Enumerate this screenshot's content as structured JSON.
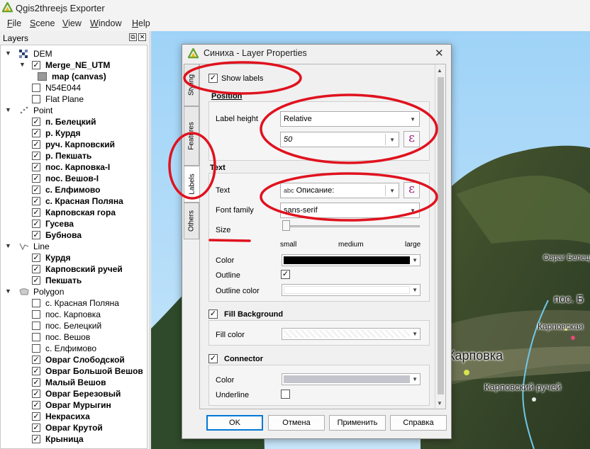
{
  "app": {
    "title": "Qgis2threejs Exporter",
    "accent": "#65a32d"
  },
  "menu": [
    {
      "label": "File",
      "u": "F",
      "rest": "ile"
    },
    {
      "label": "Scene",
      "u": "S",
      "rest": "cene"
    },
    {
      "label": "View",
      "u": "V",
      "rest": "iew"
    },
    {
      "label": "Window",
      "u": "W",
      "rest": "indow"
    },
    {
      "label": "Help",
      "u": "H",
      "rest": "elp"
    }
  ],
  "layers_panel": {
    "title": "Layers",
    "float_icon": "⧉",
    "close_icon": "✕",
    "items": [
      {
        "label": "DEM",
        "level": 0,
        "expand": "▼",
        "icon": "dem-group-icon",
        "bold": false
      },
      {
        "label": "Merge_NE_UTM",
        "level": 1,
        "expand": "▼",
        "checked": true,
        "bold": true
      },
      {
        "label": "map (canvas)",
        "level": 2,
        "icon": "raster-icon",
        "bold": true
      },
      {
        "label": "N54E044",
        "level": 1,
        "checked": false,
        "bold": false
      },
      {
        "label": "Flat Plane",
        "level": 1,
        "checked": false,
        "bold": false
      },
      {
        "label": "Point",
        "level": 0,
        "expand": "▼",
        "icon": "point-group-icon",
        "bold": false
      },
      {
        "label": "п. Белецкий",
        "level": 1,
        "checked": true,
        "bold": true
      },
      {
        "label": "р. Курдя",
        "level": 1,
        "checked": true,
        "bold": true
      },
      {
        "label": "руч. Карповский",
        "level": 1,
        "checked": true,
        "bold": true
      },
      {
        "label": "р. Пекшать",
        "level": 1,
        "checked": true,
        "bold": true
      },
      {
        "label": "пос. Карповка-I",
        "level": 1,
        "checked": true,
        "bold": true
      },
      {
        "label": "пос. Вешов-I",
        "level": 1,
        "checked": true,
        "bold": true
      },
      {
        "label": "с. Елфимово",
        "level": 1,
        "checked": true,
        "bold": true
      },
      {
        "label": "с. Красная Поляна",
        "level": 1,
        "checked": true,
        "bold": true
      },
      {
        "label": "Карповская гора",
        "level": 1,
        "checked": true,
        "bold": true
      },
      {
        "label": "Гусева",
        "level": 1,
        "checked": true,
        "bold": true
      },
      {
        "label": "Бубнова",
        "level": 1,
        "checked": true,
        "bold": true
      },
      {
        "label": "Line",
        "level": 0,
        "expand": "▼",
        "icon": "line-group-icon",
        "bold": false
      },
      {
        "label": "Курдя",
        "level": 1,
        "checked": true,
        "bold": true
      },
      {
        "label": "Карповский ручей",
        "level": 1,
        "checked": true,
        "bold": true
      },
      {
        "label": "Пекшать",
        "level": 1,
        "checked": true,
        "bold": true
      },
      {
        "label": "Polygon",
        "level": 0,
        "expand": "▼",
        "icon": "polygon-group-icon",
        "bold": false
      },
      {
        "label": "с. Красная Поляна",
        "level": 1,
        "checked": false,
        "bold": false
      },
      {
        "label": "пос. Карповка",
        "level": 1,
        "checked": false,
        "bold": false
      },
      {
        "label": "пос. Белецкий",
        "level": 1,
        "checked": false,
        "bold": false
      },
      {
        "label": "пос. Вешов",
        "level": 1,
        "checked": false,
        "bold": false
      },
      {
        "label": "с. Елфимово",
        "level": 1,
        "checked": false,
        "bold": false
      },
      {
        "label": "Овраг Слободской",
        "level": 1,
        "checked": true,
        "bold": true
      },
      {
        "label": "Овраг Большой Вешов",
        "level": 1,
        "checked": true,
        "bold": true
      },
      {
        "label": "Малый Вешов",
        "level": 1,
        "checked": true,
        "bold": true
      },
      {
        "label": "Овраг Березовый",
        "level": 1,
        "checked": true,
        "bold": true
      },
      {
        "label": "Овраг Мурыгин",
        "level": 1,
        "checked": true,
        "bold": true
      },
      {
        "label": "Некрасиха",
        "level": 1,
        "checked": true,
        "bold": true
      },
      {
        "label": "Овраг Крутой",
        "level": 1,
        "checked": true,
        "bold": true
      },
      {
        "label": "Крыница",
        "level": 1,
        "checked": true,
        "bold": true
      }
    ]
  },
  "map_labels": [
    {
      "text": "Овраг Белецк",
      "size": 11
    },
    {
      "text": "пос. Б",
      "size": 15
    },
    {
      "text": "Карповская",
      "size": 12
    },
    {
      "text": "Карповка",
      "size": 18
    },
    {
      "text": "Карповский ручей",
      "size": 13
    }
  ],
  "dialog": {
    "title": "Синиха - Layer Properties",
    "close": "✕",
    "tabs": [
      {
        "label": "Styling",
        "active": false
      },
      {
        "label": "Features",
        "active": false
      },
      {
        "label": "Labels",
        "active": true
      },
      {
        "label": "Others",
        "active": false
      }
    ],
    "show_labels": {
      "label": "Show labels",
      "checked": true
    },
    "position": {
      "title": "Position",
      "label_height_label": "Label height",
      "label_height_value": "Relative",
      "height_value": "50",
      "expr_glyph": "ε"
    },
    "text": {
      "title": "Text",
      "text_label": "Text",
      "text_prefix": "abc",
      "text_value": "Описание:",
      "font_family_label": "Font family",
      "font_family_value": "sans-serif",
      "size_label": "Size",
      "size_slider_position": 0,
      "size_ticks": [
        "small",
        "medium",
        "large"
      ],
      "color_label": "Color",
      "color_value": "#000000",
      "outline_label": "Outline",
      "outline_checked": true,
      "outline_color_label": "Outline color",
      "outline_color_value": "#ffffff"
    },
    "fill_background": {
      "title": "Fill Background",
      "checked": true,
      "fill_color_label": "Fill color"
    },
    "connector": {
      "title": "Connector",
      "checked": true,
      "color_label": "Color",
      "color_value": "#c4c4cc",
      "underline_label": "Underline",
      "underline_checked": false
    },
    "buttons": {
      "ok": "OK",
      "cancel": "Отмена",
      "apply": "Применить",
      "help": "Справка"
    }
  },
  "annotation_color": "#e0121e"
}
